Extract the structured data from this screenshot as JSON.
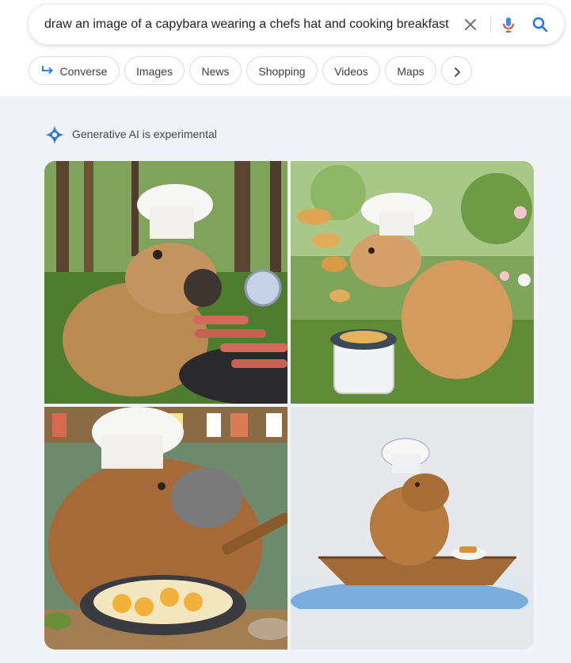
{
  "search": {
    "query": "draw an image of a capybara wearing a chefs hat and cooking breakfast"
  },
  "chips": [
    {
      "label": "Converse"
    },
    {
      "label": "Images"
    },
    {
      "label": "News"
    },
    {
      "label": "Shopping"
    },
    {
      "label": "Videos"
    },
    {
      "label": "Maps"
    }
  ],
  "icons": {
    "clear": "close-icon",
    "mic": "microphone-icon",
    "search": "search-icon",
    "more": "chevron-right-icon",
    "ai": "sparkle-icon"
  },
  "ai": {
    "label": "Generative AI is experimental"
  },
  "colors": {
    "accent": "#1a73e8",
    "chip_border": "#dadce0",
    "panel_bg": "#f0f4f9"
  }
}
